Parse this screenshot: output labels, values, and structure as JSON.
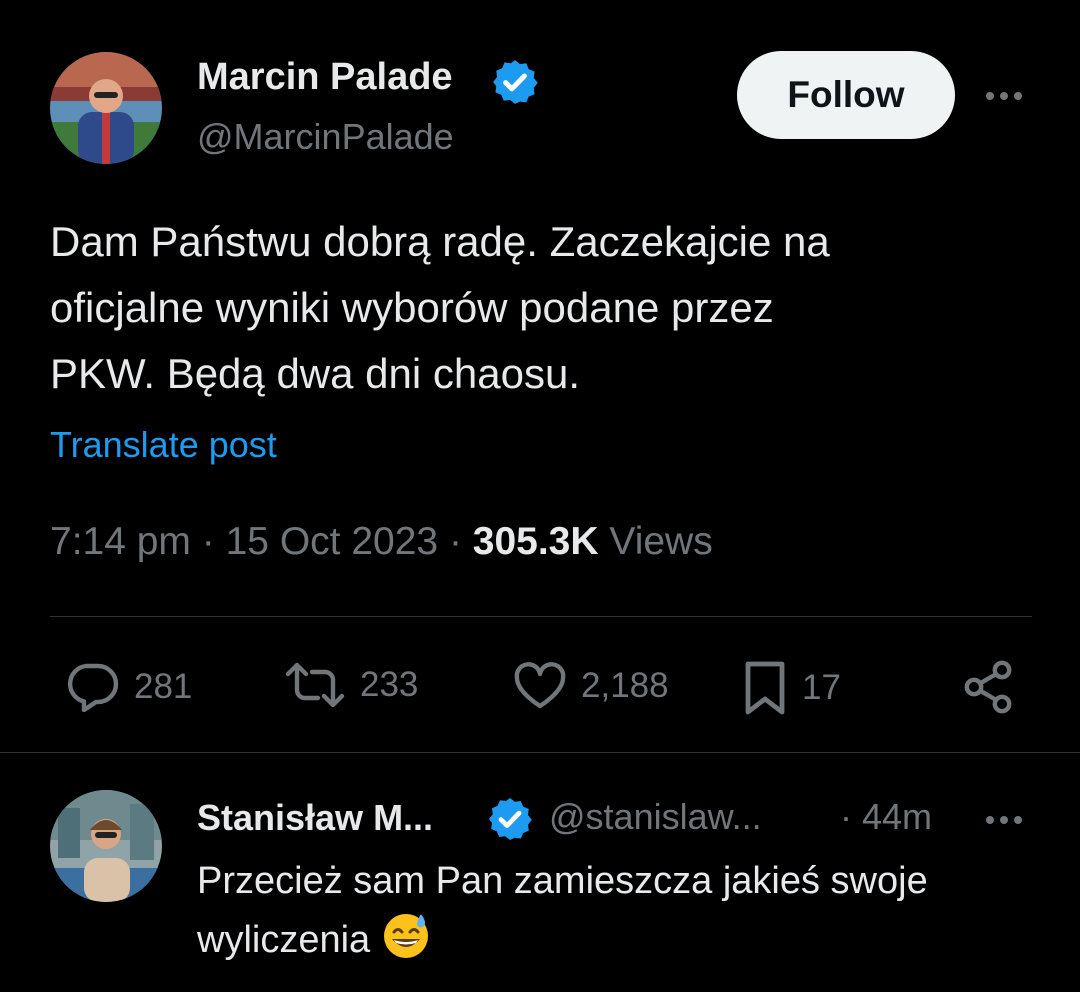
{
  "post": {
    "author_name": "Marcin Palade",
    "author_handle": "@MarcinPalade",
    "follow_label": "Follow",
    "text": "Dam Państwu dobrą radę. Zaczekajcie na\noficjalne wyniki wyborów podane przez\nPKW. Będą dwa dni chaosu.",
    "translate_label": "Translate post",
    "time": "7:14 pm",
    "date": "15 Oct 2023",
    "views_count": "305.3K",
    "views_label": "Views",
    "actions": {
      "replies": "281",
      "reposts": "233",
      "likes": "2,188",
      "bookmarks": "17"
    }
  },
  "reply": {
    "author_name": "Stanisław M...",
    "author_handle": "@stanislaw...",
    "age": "· 44m",
    "text": "Przecież sam Pan zamieszcza jakieś swoje wyliczenia"
  },
  "colors": {
    "background": "#000000",
    "text": "#e7e9ea",
    "secondary": "#71767b",
    "accent": "#1d9bf0",
    "verified": "#1d9bf0"
  }
}
